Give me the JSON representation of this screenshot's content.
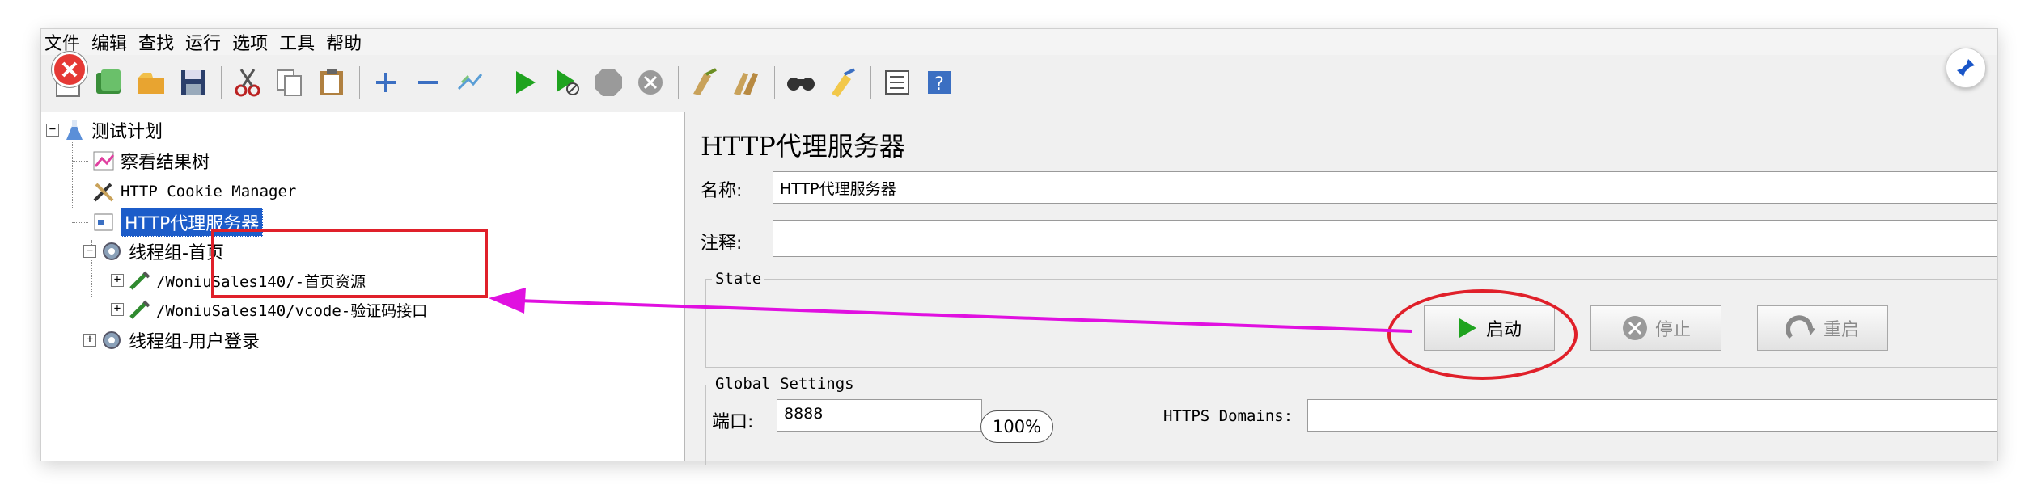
{
  "menu": [
    "文件",
    "编辑",
    "查找",
    "运行",
    "选项",
    "工具",
    "帮助"
  ],
  "toolbar_icons": [
    "new-icon",
    "templates-icon",
    "open-icon",
    "save-icon",
    "cut-icon",
    "copy-icon",
    "paste-icon",
    "expand-icon",
    "collapse-icon",
    "toggle-icon",
    "start-icon",
    "start-no-pause-icon",
    "stop-icon",
    "shutdown-icon",
    "clear-icon",
    "clear-all-icon",
    "search-icon",
    "reset-search-icon",
    "function-helper-icon",
    "help-icon"
  ],
  "tree": {
    "items": [
      {
        "label": "测试计划"
      },
      {
        "label": "察看结果树"
      },
      {
        "label": "HTTP Cookie Manager"
      },
      {
        "label": "HTTP代理服务器"
      },
      {
        "label": "线程组-首页"
      },
      {
        "label": "/WoniuSales140/-首页资源"
      },
      {
        "label": "/WoniuSales140/vcode-验证码接口"
      },
      {
        "label": "线程组-用户登录"
      }
    ]
  },
  "proxy": {
    "title": "HTTP代理服务器",
    "name_label": "名称:",
    "name_value": "HTTP代理服务器",
    "comment_label": "注释:",
    "comment_value": "",
    "state_label": "State",
    "start_label": "启动",
    "stop_label": "停止",
    "restart_label": "重启",
    "global_label": "Global Settings",
    "port_label": "端口:",
    "port_value": "8888",
    "https_label": "HTTPS Domains:",
    "https_value": ""
  },
  "zoom": "100%",
  "colors": {
    "highlight_red": "#e0202a",
    "arrow_magenta": "#e010e0",
    "selection_blue": "#1c5cc9",
    "start_green": "#1fa31f"
  }
}
